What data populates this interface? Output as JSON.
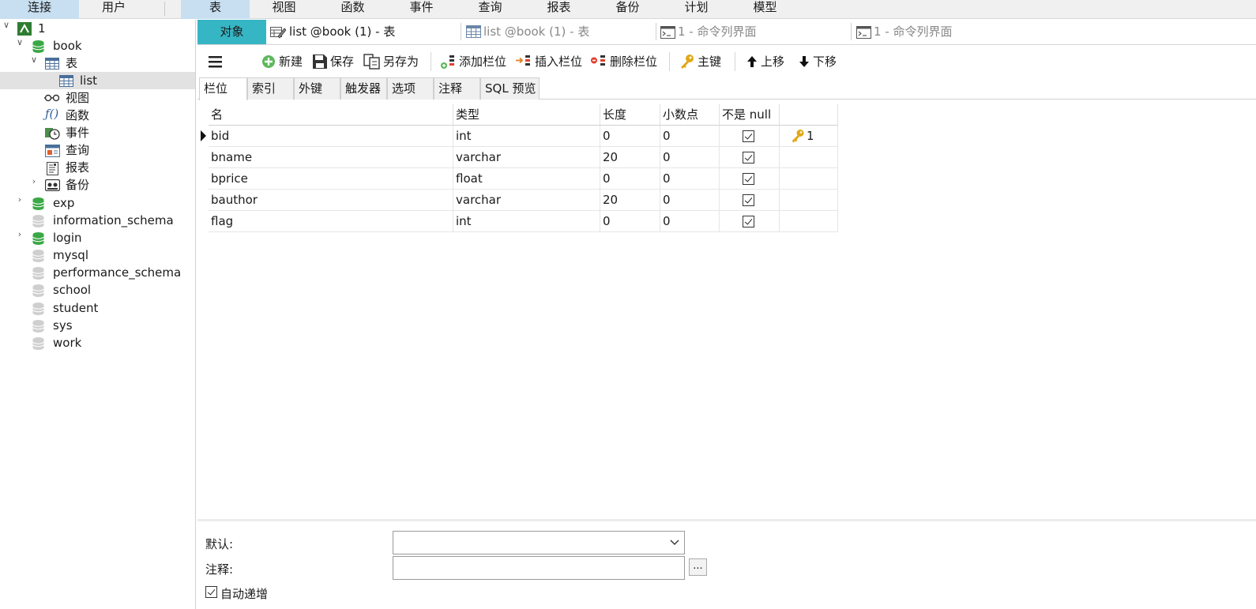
{
  "ribbon": {
    "left": [
      "连接",
      "用户"
    ],
    "right": [
      "表",
      "视图",
      "函数",
      "事件",
      "查询",
      "报表",
      "备份",
      "计划",
      "模型"
    ]
  },
  "tree": {
    "connection": "1",
    "db_book": "book",
    "tables_group": "表",
    "table_list": "list",
    "views": "视图",
    "functions": "函数",
    "events": "事件",
    "queries": "查询",
    "reports": "报表",
    "backups": "备份",
    "other_dbs": [
      "exp",
      "information_schema",
      "login",
      "mysql",
      "performance_schema",
      "school",
      "student",
      "sys",
      "work"
    ]
  },
  "tabs": {
    "objects": "对象",
    "active": "list @book (1) - 表",
    "second": "list @book (1) - 表",
    "cmd1": "1 - 命令列界面",
    "cmd2": "1 - 命令列界面"
  },
  "toolbar": {
    "new": "新建",
    "save": "保存",
    "save_as": "另存为",
    "add_field": "添加栏位",
    "insert_field": "插入栏位",
    "delete_field": "删除栏位",
    "primary_key": "主键",
    "move_up": "上移",
    "move_down": "下移"
  },
  "subtabs": [
    "栏位",
    "索引",
    "外键",
    "触发器",
    "选项",
    "注释",
    "SQL 预览"
  ],
  "grid": {
    "headers": [
      "名",
      "类型",
      "长度",
      "小数点",
      "不是 null",
      ""
    ],
    "rows": [
      {
        "name": "bid",
        "type": "int",
        "length": "0",
        "decimals": "0",
        "not_null": true,
        "key": "1"
      },
      {
        "name": "bname",
        "type": "varchar",
        "length": "20",
        "decimals": "0",
        "not_null": true,
        "key": ""
      },
      {
        "name": "bprice",
        "type": "float",
        "length": "0",
        "decimals": "0",
        "not_null": true,
        "key": ""
      },
      {
        "name": "bauthor",
        "type": "varchar",
        "length": "20",
        "decimals": "0",
        "not_null": true,
        "key": ""
      },
      {
        "name": "flag",
        "type": "int",
        "length": "0",
        "decimals": "0",
        "not_null": true,
        "key": ""
      }
    ]
  },
  "bottom": {
    "default_label": "默认:",
    "default_value": "",
    "comment_label": "注释:",
    "comment_value": "",
    "ellipsis": "...",
    "auto_increment_label": "自动递增",
    "auto_increment_checked": true
  },
  "colors": {
    "ribbon_selected": "#c7dff1",
    "objects_tab": "#36b5c4",
    "db_open": "#3aa845",
    "db_closed": "#cfcfcf",
    "key": "#e0a818"
  }
}
